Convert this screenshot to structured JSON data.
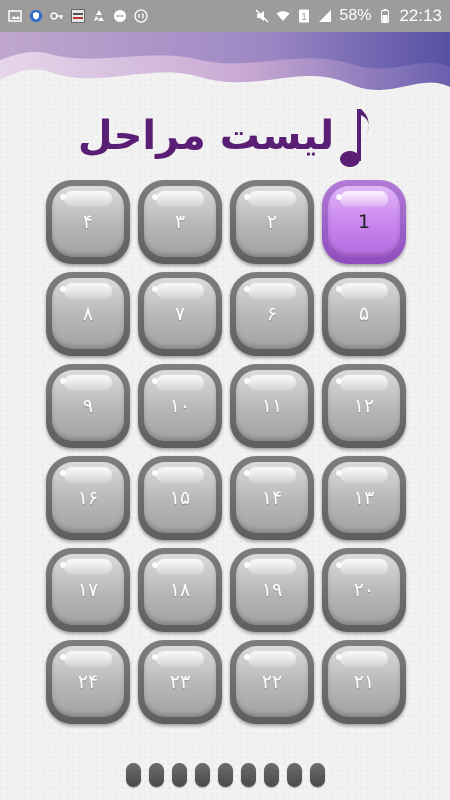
{
  "status_bar": {
    "battery_percent": "58%",
    "time": "22:13",
    "left_icons": [
      "gallery-icon",
      "shield-app-icon",
      "key-icon",
      "basic-app-icon",
      "recycle-icon",
      "chat-icon",
      "number-badge-icon"
    ],
    "right_icons": [
      "mute-icon",
      "wifi-icon",
      "sim-icon",
      "signal-icon",
      "battery-icon"
    ]
  },
  "header": {
    "title": "لیست مراحل",
    "accent_color": "#5a1f74"
  },
  "levels": [
    {
      "label": "۴"
    },
    {
      "label": "۳"
    },
    {
      "label": "۲"
    },
    {
      "label": "1",
      "active": true
    },
    {
      "label": "۸"
    },
    {
      "label": "۷"
    },
    {
      "label": "۶"
    },
    {
      "label": "۵"
    },
    {
      "label": "۹"
    },
    {
      "label": "۱۰"
    },
    {
      "label": "۱۱"
    },
    {
      "label": "۱۲"
    },
    {
      "label": "۱۶"
    },
    {
      "label": "۱۵"
    },
    {
      "label": "۱۴"
    },
    {
      "label": "۱۳"
    },
    {
      "label": "۱۷"
    },
    {
      "label": "۱۸"
    },
    {
      "label": "۱۹"
    },
    {
      "label": "۲۰"
    },
    {
      "label": "۲۴"
    },
    {
      "label": "۲۳"
    },
    {
      "label": "۲۲"
    },
    {
      "label": "۲۱"
    }
  ],
  "pager": {
    "count": 9
  },
  "colors": {
    "status_bar_bg": "#9c9c9c",
    "active_level": "#c884ee",
    "inactive_level": "#b7b7b7"
  }
}
